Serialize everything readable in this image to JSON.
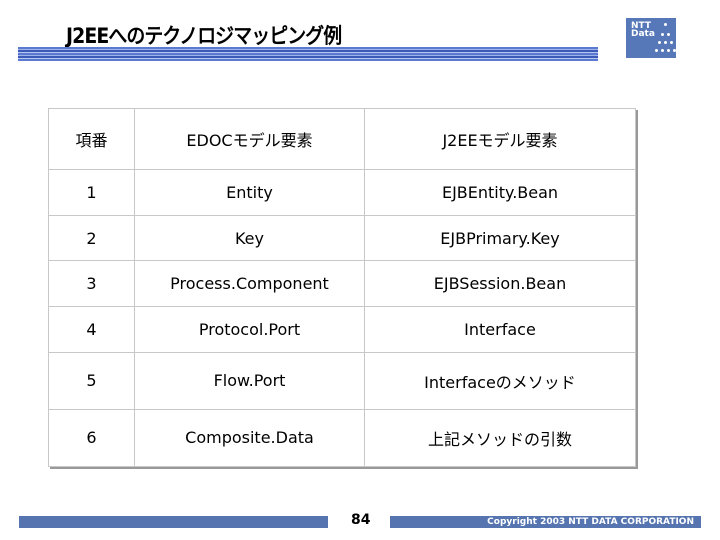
{
  "title": "J2EEへのテクノロジマッピング例",
  "logo": "NTT Data",
  "table": {
    "headers": [
      "項番",
      "EDOCモデル要素",
      "J2EEモデル要素"
    ],
    "rows": [
      [
        "1",
        "Entity",
        "EJBEntity.Bean"
      ],
      [
        "2",
        "Key",
        "EJBPrimary.Key"
      ],
      [
        "3",
        "Process.Component",
        "EJBSession.Bean"
      ],
      [
        "4",
        "Protocol.Port",
        "Interface"
      ],
      [
        "5",
        "Flow.Port",
        "Interfaceのメソッド"
      ],
      [
        "6",
        "Composite.Data",
        "上記メソッドの引数"
      ]
    ]
  },
  "footer": {
    "page": "84",
    "copyright": "Copyright 2003 NTT DATA CORPORATION"
  }
}
